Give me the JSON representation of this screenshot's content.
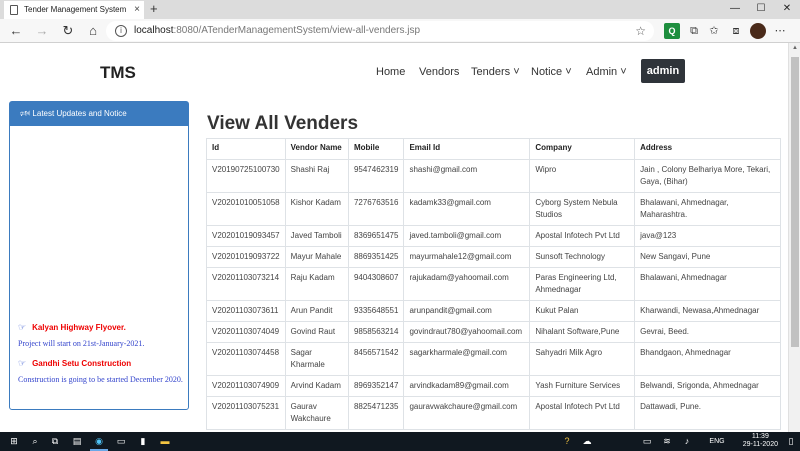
{
  "browser": {
    "tab_title": "Tender Management System",
    "tab_close": "×",
    "new_tab": "+",
    "win_min": "—",
    "win_max": "☐",
    "win_close": "✕",
    "back": "←",
    "forward": "→",
    "reload": "↻",
    "home": "⌂",
    "url_host": "localhost",
    "url_path": ":8080/ATenderManagementSystem/view-all-venders.jsp",
    "star": "☆",
    "ext_q": "Q",
    "ext_puzzle": "⧉",
    "favorites": "✩",
    "collections": "⧈",
    "menu": "⋯"
  },
  "navbar": {
    "brand": "TMS",
    "items": [
      {
        "label": "Home"
      },
      {
        "label": "Vendors"
      },
      {
        "label": "Tenders ˅"
      },
      {
        "label": "Notice ˅"
      },
      {
        "label": "Admin ˅"
      }
    ],
    "user": "admin"
  },
  "panel": {
    "header": "🕬 Latest Updates and Notice",
    "notices": [
      {
        "title": "Kalyan Highway Flyover.",
        "text": "Project will start on 21st-January-2021."
      },
      {
        "title": "Gandhi Setu Construction",
        "text": "Construction is going to be started December 2020."
      }
    ]
  },
  "main": {
    "title": "View All Venders",
    "columns": [
      "Id",
      "Vendor Name",
      "Mobile",
      "Email Id",
      "Company",
      "Address"
    ],
    "rows": [
      [
        "V20190725100730",
        "Shashi Raj",
        "9547462319",
        "shashi@gmail.com",
        "Wipro",
        "Jain , Colony Belhariya More, Tekari, Gaya, (Bihar)"
      ],
      [
        "V20201010051058",
        "Kishor Kadam",
        "7276763516",
        "kadamk33@gmail.com",
        "Cyborg System Nebula Studios",
        "Bhalawani, Ahmednagar, Maharashtra."
      ],
      [
        "V20201019093457",
        "Javed Tamboli",
        "8369651475",
        "javed.tamboli@gmail.com",
        "Apostal Infotech Pvt Ltd",
        "java@123"
      ],
      [
        "V20201019093722",
        "Mayur Mahale",
        "8869351425",
        "mayurmahale12@gmail.com",
        "Sunsoft Technology",
        "New Sangavi, Pune"
      ],
      [
        "V20201103073214",
        "Raju Kadam",
        "9404308607",
        "rajukadam@yahoomail.com",
        "Paras Engineering Ltd, Ahmednagar",
        "Bhalawani, Ahmednagar"
      ],
      [
        "V20201103073611",
        "Arun Pandit",
        "9335648551",
        "arunpandit@gmail.com",
        "Kukut Palan",
        "Kharwandi, Newasa,Ahmednagar"
      ],
      [
        "V20201103074049",
        "Govind Raut",
        "9858563214",
        "govindraut780@yahoomail.com",
        "Nihalant Software,Pune",
        "Gevrai, Beed."
      ],
      [
        "V20201103074458",
        "Sagar Kharmale",
        "8456571542",
        "sagarkharmale@gmail.com",
        "Sahyadri Milk Agro",
        "Bhandgaon, Ahmednagar"
      ],
      [
        "V20201103074909",
        "Arvind Kadam",
        "8969352147",
        "arvindkadam89@gmail.com",
        "Yash Furniture Services",
        "Belwandi, Srigonda, Ahmednagar"
      ],
      [
        "V20201103075231",
        "Gaurav Wakchaure",
        "8825471235",
        "gauravwakchaure@gmail.com",
        "Apostal Infotech Pvt Ltd",
        "Dattawadi, Pune."
      ]
    ]
  },
  "taskbar": {
    "lang": "ENG",
    "time": "11:39",
    "date": "29-11-2020"
  },
  "colors": {
    "panel_blue": "#3b7bbf",
    "notice_red": "#e00000",
    "admin_dark": "#2f343a"
  }
}
